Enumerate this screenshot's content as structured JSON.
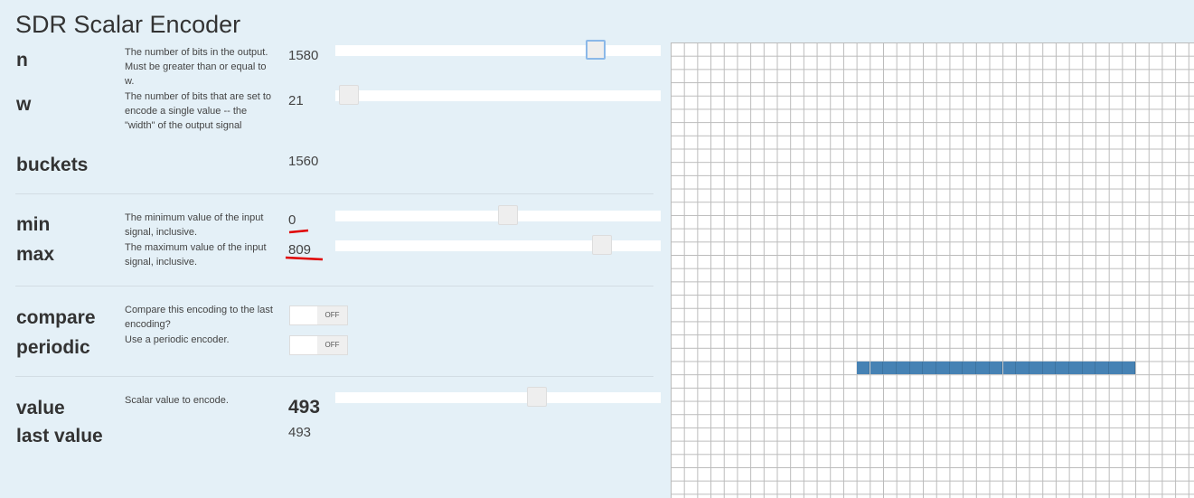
{
  "title": "SDR Scalar Encoder",
  "params": {
    "n": {
      "label": "n",
      "desc": "The number of bits in the output. Must be greater than or equal to w.",
      "value": "1580",
      "slider": 0.77
    },
    "w": {
      "label": "w",
      "desc": "The number of bits that are set to encode a single value -- the \"width\" of the output signal",
      "value": "21",
      "slider": 0.01
    },
    "buckets": {
      "label": "buckets",
      "value": "1560"
    },
    "min": {
      "label": "min",
      "desc": "The minimum value of the input signal, inclusive.",
      "value": "0",
      "slider": 0.5
    },
    "max": {
      "label": "max",
      "desc": "The maximum value of the input signal, inclusive.",
      "value": "809",
      "slider": 0.79
    },
    "compare": {
      "label": "compare",
      "desc": "Compare this encoding to the last encoding?",
      "state": "OFF"
    },
    "periodic": {
      "label": "periodic",
      "desc": "Use a periodic encoder.",
      "state": "OFF"
    },
    "value": {
      "label": "value",
      "desc": "Scalar value to encode.",
      "value": "493",
      "slider": 0.59
    },
    "last_value": {
      "label": "last value",
      "value": "493"
    }
  },
  "sdr": {
    "active_color": "#4682b4",
    "active_row": 24,
    "active_start_col": 14,
    "active_count": 21
  },
  "annotation_color": "#e00000"
}
